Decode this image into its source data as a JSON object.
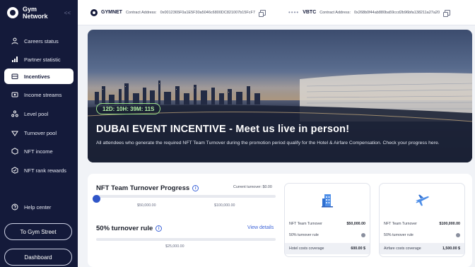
{
  "brand": {
    "name": "Gym Network",
    "collapse_glyph": "<<"
  },
  "sidebar": {
    "items": [
      {
        "label": "Careers status",
        "icon": "person-icon",
        "active": false
      },
      {
        "label": "Partner statistic",
        "icon": "bar-chart-icon",
        "active": false
      },
      {
        "label": "Incentives",
        "icon": "incentive-icon",
        "active": true
      },
      {
        "label": "Income streams",
        "icon": "income-icon",
        "active": false
      },
      {
        "label": "Level pool",
        "icon": "level-pool-icon",
        "active": false
      },
      {
        "label": "Turnover pool",
        "icon": "turnover-icon",
        "active": false
      },
      {
        "label": "NFT income",
        "icon": "nft-icon",
        "active": false
      },
      {
        "label": "NFT rank rewards",
        "icon": "nft-rank-icon",
        "active": false
      }
    ],
    "help_label": "Help center",
    "gym_street_label": "To Gym Street",
    "dashboard_label": "Dashboard"
  },
  "topbar": {
    "token1": {
      "name": "GYMNET",
      "label": "Contract Address:",
      "address": "0x0012365F0a1E5F30a5046c6800DC821007b15FcF7"
    },
    "token2": {
      "name": "VBTC",
      "label": "Contract Address:",
      "address": "0x268b0f44ab880ba59ccd2b96bfa138211a27a20"
    }
  },
  "hero": {
    "countdown": "12D: 10H: 39M: 11S",
    "title": "DUBAI EVENT INCENTIVE - Meet us live in person!",
    "description": "All attendees who generate the required NFT Team Turnover during the promotion period qualify for the Hotel & Airfare Compensation. Check your progress here."
  },
  "progress": {
    "title": "NFT Team Turnover Progress",
    "current_label": "Current turnover: $0.00",
    "current_value": 0,
    "milestones": [
      "$50,000.00",
      "$100,000.00"
    ],
    "rule_title": "50% turnover rule",
    "view_details": "View details",
    "rule_milestone": "$25,000.00"
  },
  "rewards": [
    {
      "icon": "hotel-icon",
      "turnover_label": "NFT Team Turnover",
      "turnover_value": "$50,000.00",
      "rule_label": "50% turnover rule",
      "coverage_label": "Hotel costs coverage",
      "coverage_value": "600.00 $"
    },
    {
      "icon": "airplane-icon",
      "turnover_label": "NFT Team Turnover",
      "turnover_value": "$100,000.00",
      "rule_label": "50% turnover rule",
      "coverage_label": "Airfare costs coverage",
      "coverage_value": "1,500.00 $"
    }
  ],
  "colors": {
    "sidebar": "#141a3a",
    "accent": "#2f55c8",
    "countdown": "#9be28a"
  }
}
